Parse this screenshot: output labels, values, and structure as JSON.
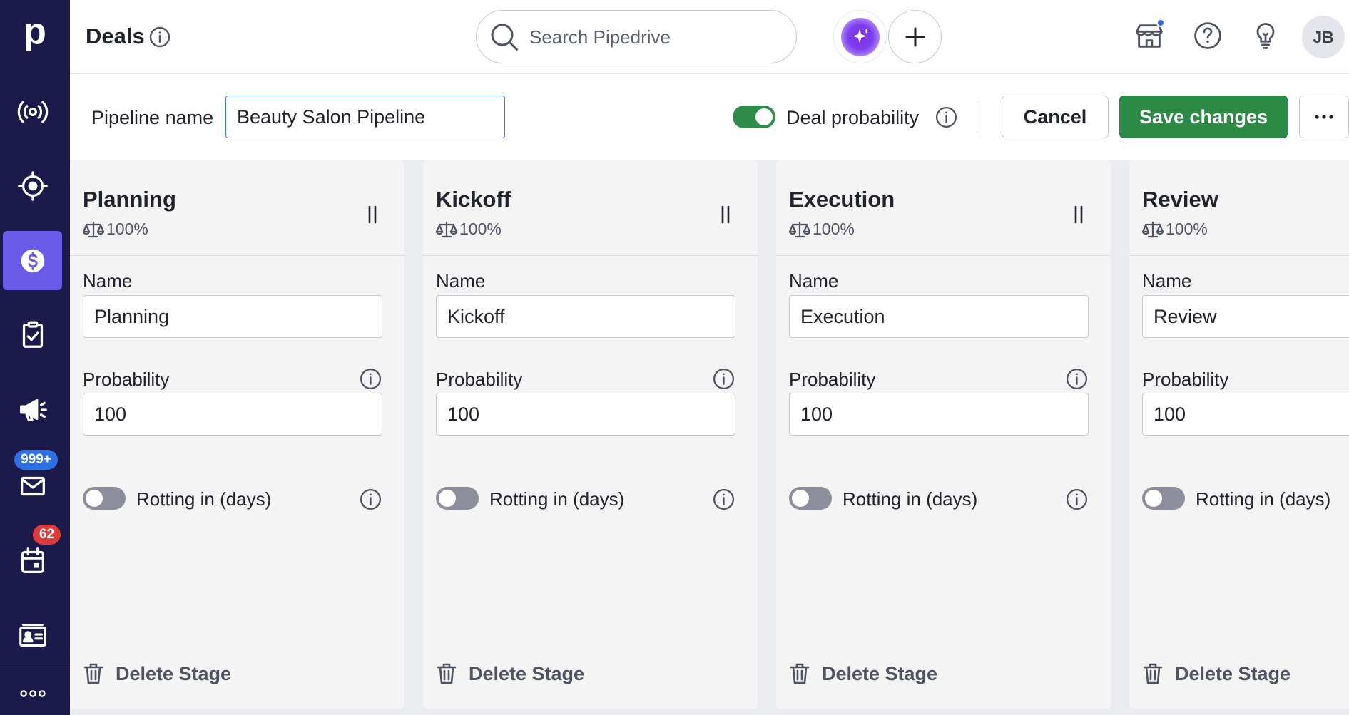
{
  "colors": {
    "sidebar_bg": "#1b1a4a",
    "sidebar_active": "#6b5ce7",
    "primary_green": "#2b8a46",
    "focus_blue": "#3b7de0",
    "badge_blue": "#2f6fe4",
    "badge_red": "#e03b3b"
  },
  "sidebar": {
    "logo": "p",
    "items": [
      {
        "name": "leads-inbox",
        "icon": "broadcast-icon"
      },
      {
        "name": "projects",
        "icon": "target-icon"
      },
      {
        "name": "deals",
        "icon": "dollar-icon",
        "active": true
      },
      {
        "name": "activities",
        "icon": "clipboard-check-icon"
      },
      {
        "name": "campaigns",
        "icon": "megaphone-icon"
      },
      {
        "name": "mail",
        "icon": "mail-icon",
        "badge": "999+"
      },
      {
        "name": "calendar",
        "icon": "calendar-icon",
        "badge": "62"
      },
      {
        "name": "contacts",
        "icon": "contact-card-icon"
      },
      {
        "name": "more",
        "icon": "more-dots-icon"
      }
    ]
  },
  "header": {
    "title": "Deals",
    "search_placeholder": "Search Pipedrive",
    "avatar_initials": "JB"
  },
  "pipeline": {
    "name_label": "Pipeline name",
    "name_value": "Beauty Salon Pipeline",
    "deal_probability_label": "Deal probability",
    "deal_probability_on": true,
    "cancel_label": "Cancel",
    "save_label": "Save changes"
  },
  "stage_common": {
    "name_label": "Name",
    "probability_label": "Probability",
    "rotting_label": "Rotting in (days)",
    "delete_label": "Delete Stage"
  },
  "stages": [
    {
      "title": "Planning",
      "probability_display": "100%",
      "name": "Planning",
      "probability": "100",
      "rotting_on": false
    },
    {
      "title": "Kickoff",
      "probability_display": "100%",
      "name": "Kickoff",
      "probability": "100",
      "rotting_on": false
    },
    {
      "title": "Execution",
      "probability_display": "100%",
      "name": "Execution",
      "probability": "100",
      "rotting_on": false
    },
    {
      "title": "Review",
      "probability_display": "100%",
      "name": "Review",
      "probability": "100",
      "rotting_on": false
    }
  ]
}
